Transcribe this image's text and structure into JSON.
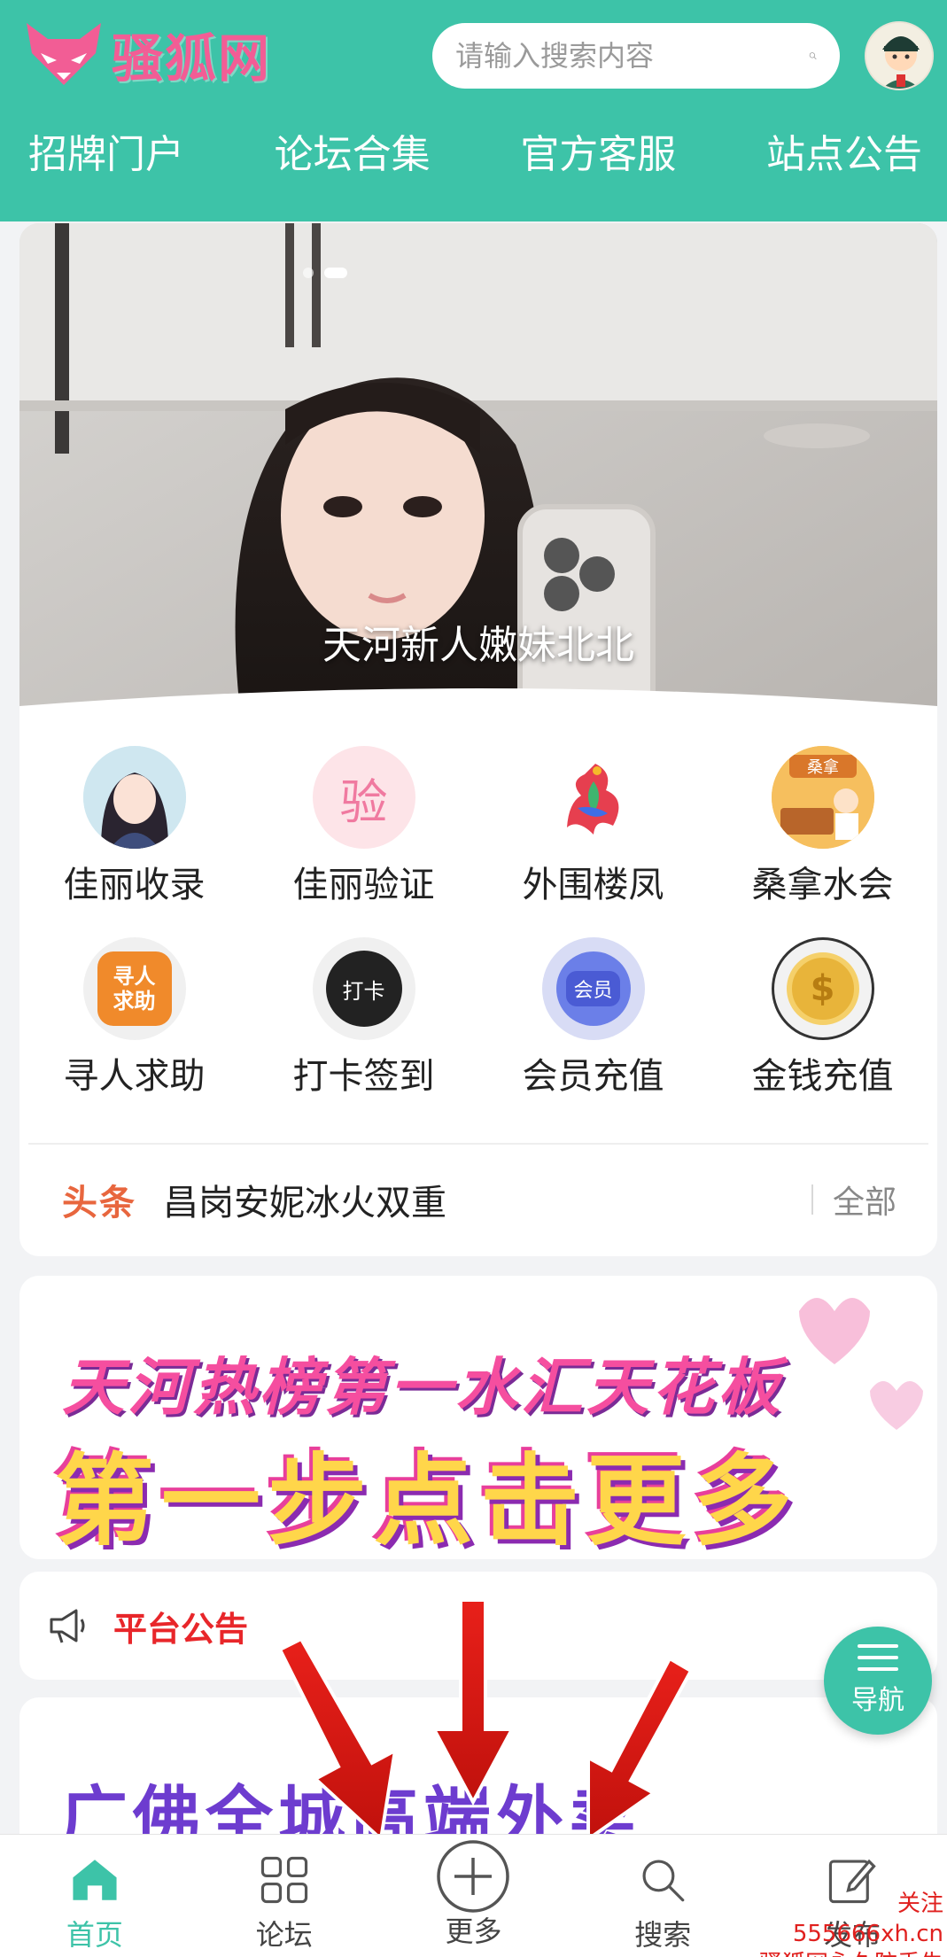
{
  "header": {
    "logo_text": "骚狐网",
    "search_placeholder": "请输入搜索内容",
    "nav": [
      "招牌门户",
      "论坛合集",
      "官方客服",
      "站点公告"
    ]
  },
  "banner": {
    "caption": "天河新人嫩妹北北",
    "slide_count": 2,
    "active_slide": 2
  },
  "categories": [
    {
      "label": "佳丽收录",
      "icon": "girl-avatar-icon"
    },
    {
      "label": "佳丽验证",
      "icon": "verify-icon",
      "icon_text": "验"
    },
    {
      "label": "外围楼凤",
      "icon": "phoenix-icon"
    },
    {
      "label": "桑拿水会",
      "icon": "sauna-icon",
      "icon_text": "桑拿"
    },
    {
      "label": "寻人求助",
      "icon": "search-person-icon",
      "icon_text": "寻人求助"
    },
    {
      "label": "打卡签到",
      "icon": "checkin-icon",
      "icon_text": "打卡"
    },
    {
      "label": "会员充值",
      "icon": "member-icon",
      "icon_text": "会员"
    },
    {
      "label": "金钱充值",
      "icon": "coin-icon",
      "icon_text": "$"
    }
  ],
  "headline": {
    "tag": "头条",
    "text": "昌岗安妮冰火双重",
    "all_label": "全部"
  },
  "promo": {
    "line1": "天河热榜第一水汇天花板",
    "line2": "第一步点击更多",
    "line3": "广佛全城高端外卖"
  },
  "notice": {
    "title": "平台公告"
  },
  "fab": {
    "label": "导航"
  },
  "bottom_nav": [
    {
      "label": "首页",
      "icon": "home-icon",
      "active": true
    },
    {
      "label": "论坛",
      "icon": "grid-icon",
      "active": false
    },
    {
      "label": "更多",
      "icon": "plus-circle-icon",
      "active": false
    },
    {
      "label": "搜索",
      "icon": "search-icon",
      "active": false
    },
    {
      "label": "发布",
      "icon": "edit-icon",
      "active": false
    }
  ],
  "watermark": {
    "line1": "关注555666xh.cn",
    "line2": "骚狐网永久防丢失"
  },
  "colors": {
    "brand": "#3dc3a8",
    "logo": "#f25d95",
    "headline_tag": "#e8663e",
    "notice_title": "#e8262a"
  }
}
